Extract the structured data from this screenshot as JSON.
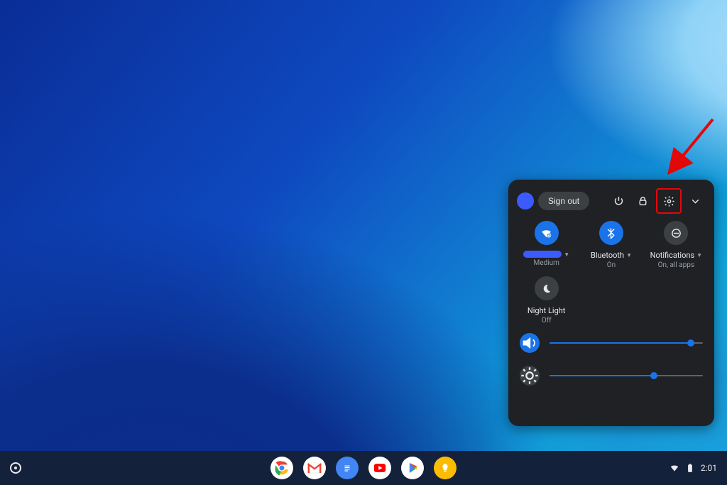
{
  "panel": {
    "signout_label": "Sign out",
    "tiles": {
      "wifi": {
        "sublabel": "Medium"
      },
      "bluetooth": {
        "label": "Bluetooth",
        "sublabel": "On"
      },
      "notifications": {
        "label": "Notifications",
        "sublabel": "On, all apps"
      },
      "nightlight": {
        "label": "Night Light",
        "sublabel": "Off"
      }
    },
    "sliders": {
      "volume_percent": 92,
      "brightness_percent": 68
    }
  },
  "shelf": {
    "time": "2:01"
  }
}
